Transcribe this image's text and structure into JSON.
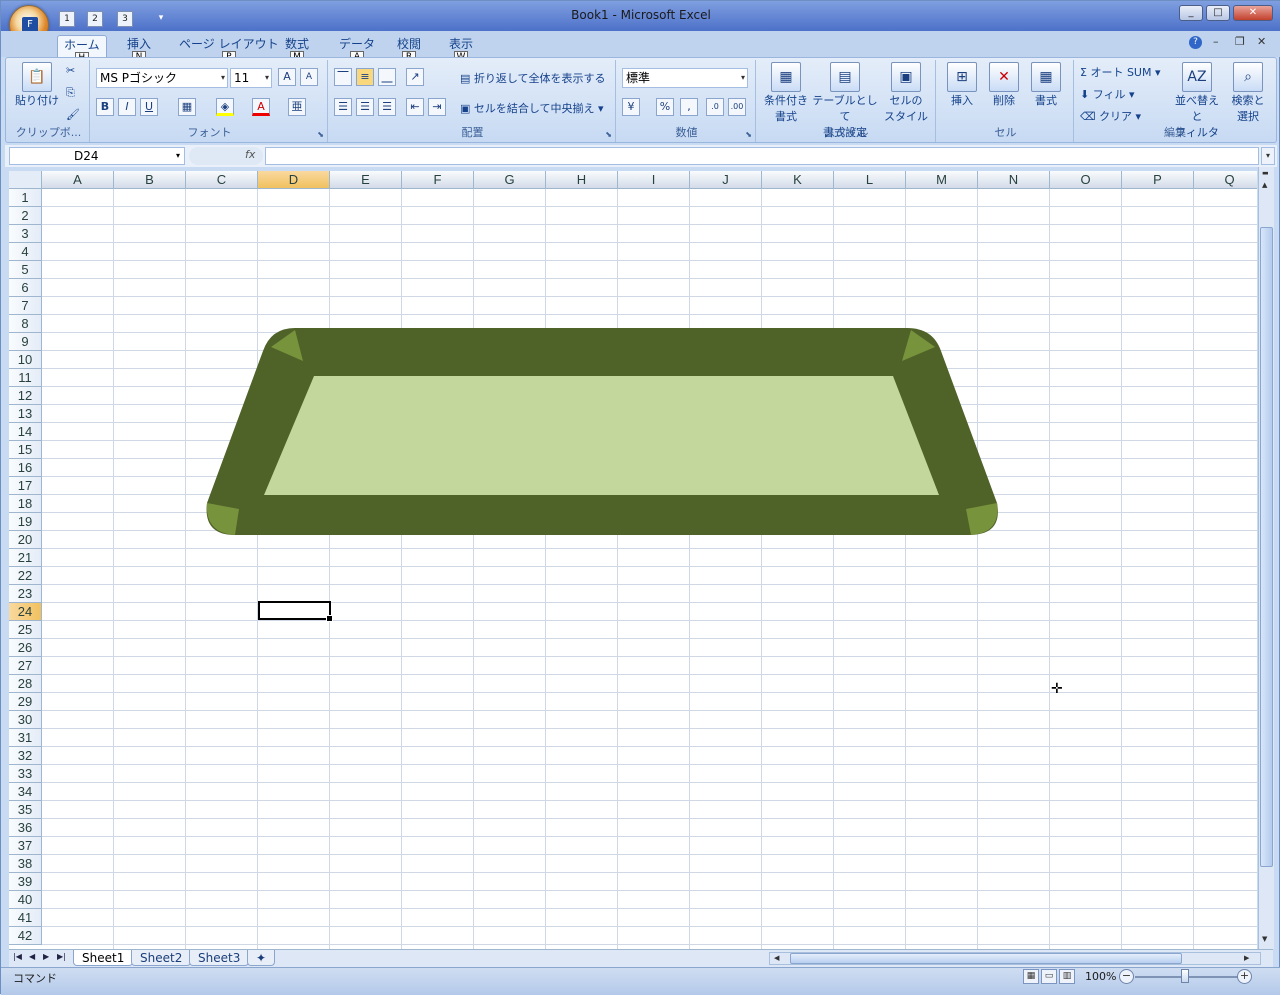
{
  "window": {
    "title": "Book1 - Microsoft Excel"
  },
  "titlebar": {
    "minimize": "_",
    "maximize": "□",
    "close": "✕"
  },
  "qat": {
    "save_keytip": "1",
    "undo_keytip": "2",
    "redo_keytip": "3",
    "customize": "▾"
  },
  "office_button": {
    "keytip": "F"
  },
  "tabs": [
    {
      "label": "ホーム",
      "keytip": "H"
    },
    {
      "label": "挿入",
      "keytip": "N"
    },
    {
      "label": "ページ レイアウト",
      "keytip": "P"
    },
    {
      "label": "数式",
      "keytip": "M"
    },
    {
      "label": "データ",
      "keytip": "A"
    },
    {
      "label": "校閲",
      "keytip": "R"
    },
    {
      "label": "表示",
      "keytip": "W"
    }
  ],
  "help": {
    "label": "?"
  },
  "ribbon": {
    "clipboard": {
      "label": "クリップボ...",
      "paste": "貼り付け"
    },
    "font": {
      "label": "フォント",
      "name": "MS Pゴシック",
      "size": "11",
      "bold": "B",
      "italic": "I",
      "underline": "U"
    },
    "alignment": {
      "label": "配置",
      "wrap": "折り返して全体を表示する",
      "merge": "セルを結合して中央揃え"
    },
    "number": {
      "label": "数値",
      "format": "標準",
      "percent": "%",
      "comma": ","
    },
    "styles": {
      "label": "スタイル",
      "conditional": [
        "条件付き",
        "書式"
      ],
      "table": [
        "テーブルとして",
        "書式設定"
      ],
      "cell": [
        "セルの",
        "スタイル"
      ]
    },
    "cells": {
      "label": "セル",
      "insert": "挿入",
      "delete": "削除",
      "format": "書式"
    },
    "editing": {
      "label": "編集",
      "autosum": "オート SUM",
      "fill": "フィル",
      "clear": "クリア",
      "sort": [
        "並べ替えと",
        "フィルタ"
      ],
      "find": [
        "検索と",
        "選択"
      ]
    }
  },
  "formula_bar": {
    "name_box": "D24",
    "fx": "fx",
    "formula": ""
  },
  "grid": {
    "columns": [
      "A",
      "B",
      "C",
      "D",
      "E",
      "F",
      "G",
      "H",
      "I",
      "J",
      "K",
      "L",
      "M",
      "N",
      "O",
      "P",
      "Q"
    ],
    "rows": [
      "1",
      "2",
      "3",
      "4",
      "5",
      "6",
      "7",
      "8",
      "9",
      "10",
      "11",
      "12",
      "13",
      "14",
      "15",
      "16",
      "17",
      "18",
      "19",
      "20",
      "21",
      "22",
      "23",
      "24",
      "25",
      "26",
      "27",
      "28",
      "29",
      "30",
      "31",
      "32",
      "33",
      "34",
      "35",
      "36",
      "37",
      "38",
      "39",
      "40",
      "41",
      "42"
    ],
    "selected_column": "D",
    "selected_row": "24"
  },
  "shape": {
    "frame_color": "#4f6228",
    "inner_color": "#c3d69b",
    "corner_color": "#77933c"
  },
  "sheet_tabs": [
    "Sheet1",
    "Sheet2",
    "Sheet3"
  ],
  "status": {
    "mode": "コマンド",
    "zoom": "100%"
  }
}
